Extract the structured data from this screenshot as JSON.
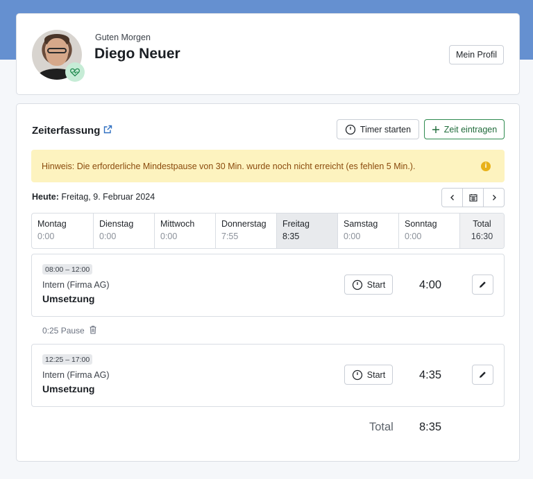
{
  "profile": {
    "greeting": "Guten Morgen",
    "name": "Diego Neuer",
    "profile_button": "Mein Profil"
  },
  "time_tracking": {
    "title": "Zeiterfassung",
    "timer_button": "Timer starten",
    "add_button": "Zeit eintragen",
    "notice": "Hinweis: Die erforderliche Mindestpause von 30 Min. wurde noch nicht erreicht (es fehlen 5 Min.).",
    "today_label": "Heute:",
    "today_value": "Freitag, 9. Februar 2024",
    "days": [
      {
        "name": "Montag",
        "value": "0:00"
      },
      {
        "name": "Dienstag",
        "value": "0:00"
      },
      {
        "name": "Mittwoch",
        "value": "0:00"
      },
      {
        "name": "Donnerstag",
        "value": "7:55"
      },
      {
        "name": "Freitag",
        "value": "8:35"
      },
      {
        "name": "Samstag",
        "value": "0:00"
      },
      {
        "name": "Sonntag",
        "value": "0:00"
      },
      {
        "name": "Total",
        "value": "16:30"
      }
    ],
    "entries": [
      {
        "range": "08:00 – 12:00",
        "client": "Intern (Firma AG)",
        "task": "Umsetzung",
        "start_label": "Start",
        "duration": "4:00"
      },
      {
        "range": "12:25 – 17:00",
        "client": "Intern (Firma AG)",
        "task": "Umsetzung",
        "start_label": "Start",
        "duration": "4:35"
      }
    ],
    "pause": "0:25 Pause",
    "total_label": "Total",
    "total_value": "8:35"
  },
  "colors": {
    "header_band": "#6590d0",
    "notice_bg": "#fdf3bf",
    "notice_text": "#8a4a0c",
    "add_button_border": "#2d8a4e",
    "active_day_bg": "#e8eaed"
  },
  "icons": [
    "health-heart-icon",
    "external-link-icon",
    "clock-icon",
    "plus-icon",
    "info-icon",
    "chevron-left-icon",
    "calendar-icon",
    "chevron-right-icon",
    "pencil-icon",
    "trash-icon"
  ]
}
